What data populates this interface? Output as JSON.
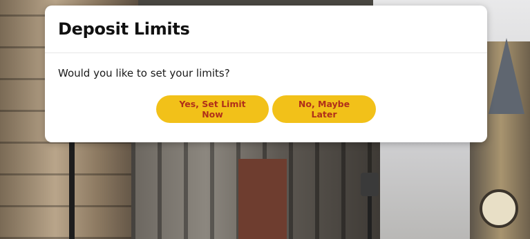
{
  "modal": {
    "title": "Deposit Limits",
    "question": "Would you like to set your limits?",
    "buttons": {
      "yes_label": "Yes, Set Limit Now",
      "no_label": "No, Maybe Later"
    }
  },
  "colors": {
    "button_bg": "#f2c119",
    "button_text": "#b0301a",
    "modal_bg": "#ffffff"
  }
}
